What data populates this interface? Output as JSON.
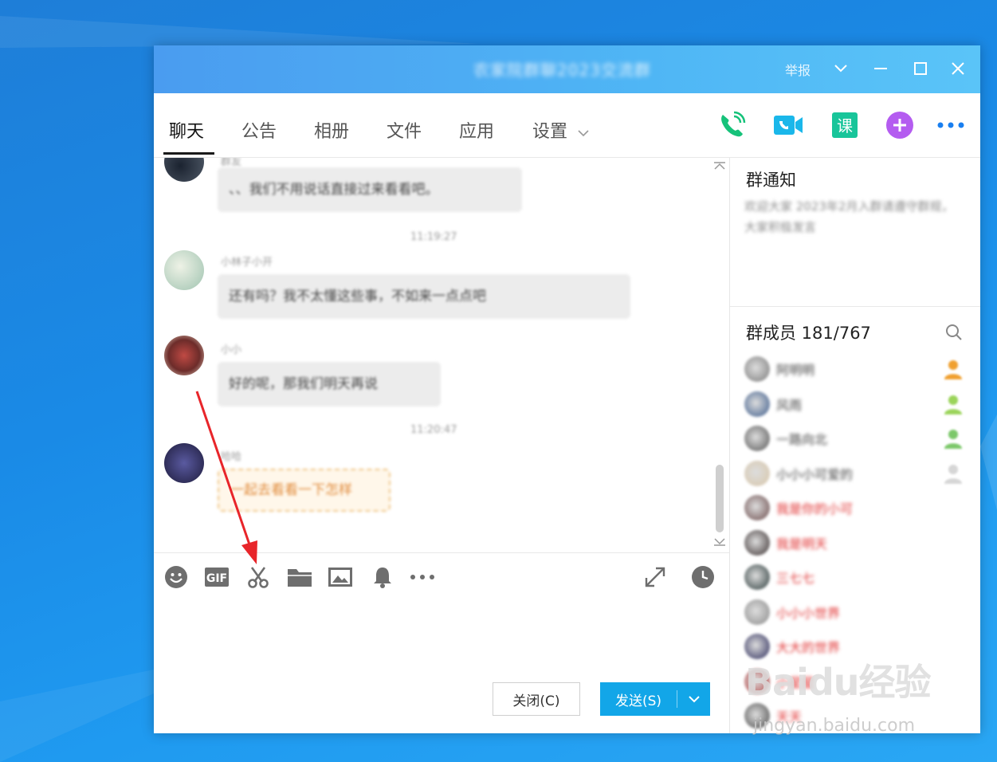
{
  "window": {
    "title": "农家院群聊2023交流群",
    "report_label": "举报"
  },
  "tabs": [
    {
      "label": "聊天"
    },
    {
      "label": "公告"
    },
    {
      "label": "相册"
    },
    {
      "label": "文件"
    },
    {
      "label": "应用"
    },
    {
      "label": "设置"
    }
  ],
  "toolbar_icons": [
    "phone-call-icon",
    "video-call-icon",
    "course-icon",
    "add-app-icon",
    "more-icon"
  ],
  "chat": {
    "messages": [
      {
        "name": "群友",
        "text": "、、我们不用说话直接过来看看吧。"
      },
      {
        "name": "小林子小开",
        "text": "还有吗？我不太懂这些事，不如来一点点吧"
      },
      {
        "name": "小小",
        "text": "好的呢，那我们明天再说"
      },
      {
        "name": "哈哈",
        "text": "一起去看看一下怎样"
      }
    ],
    "timestamps": [
      "11:19:27",
      "11:20:47"
    ]
  },
  "input_toolbar": [
    "emoji-icon",
    "gif-icon",
    "screenshot-scissors-icon",
    "folder-icon",
    "image-icon",
    "bell-icon",
    "more-options-icon",
    "expand-icon",
    "history-clock-icon"
  ],
  "buttons": {
    "close": "关闭(C)",
    "send": "发送(S)"
  },
  "side": {
    "notice_title": "群通知",
    "notice_text": "欢迎大家 2023年2月入群请遵守群规，大家积极发言",
    "members_title": "群成员 181/767",
    "members": [
      {
        "name": "阿明明",
        "color": "#444444"
      },
      {
        "name": "风雨",
        "color": "#444444"
      },
      {
        "name": "一路向北",
        "color": "#444444"
      },
      {
        "name": "小小小可爱的",
        "color": "#444444"
      },
      {
        "name": "我是你的小可",
        "color": "#e03030"
      },
      {
        "name": "我是明天",
        "color": "#e03030"
      },
      {
        "name": "三七七",
        "color": "#e03030"
      },
      {
        "name": "小小小世界",
        "color": "#e03030"
      },
      {
        "name": "大大的世界",
        "color": "#e03030"
      },
      {
        "name": "小星星",
        "color": "#e03030"
      },
      {
        "name": "天天",
        "color": "#e03030"
      }
    ]
  },
  "watermark": {
    "brand": "Baidu经验",
    "url": "jingyan.baidu.com"
  },
  "colors": {
    "accent": "#12a6e8",
    "titlebar": "#4fb6f5",
    "annotation_arrow": "#e8252a"
  }
}
